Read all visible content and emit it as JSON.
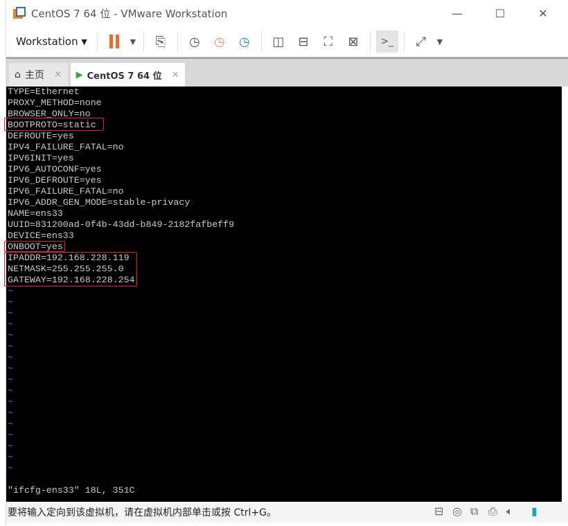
{
  "window": {
    "title": "CentOS 7 64 位 - VMware Workstation"
  },
  "toolbar": {
    "workstation_label": "Workstation"
  },
  "tabs": [
    {
      "label": "主页",
      "icon": "home-icon"
    },
    {
      "label": "CentOS 7 64 位",
      "icon": "vm-icon",
      "active": true
    }
  ],
  "terminal": {
    "lines": [
      "TYPE=Ethernet",
      "PROXY_METHOD=none",
      "BROWSER_ONLY=no",
      "BOOTPROTO=static",
      "DEFROUTE=yes",
      "IPV4_FAILURE_FATAL=no",
      "IPV6INIT=yes",
      "IPV6_AUTOCONF=yes",
      "IPV6_DEFROUTE=yes",
      "IPV6_FAILURE_FATAL=no",
      "IPV6_ADDR_GEN_MODE=stable-privacy",
      "NAME=ens33",
      "UUID=831200ad-0f4b-43dd-b849-2182fafbeff9",
      "DEVICE=ens33",
      "ONBOOT=yes",
      "IPADDR=192.168.228.119",
      "NETMASK=255.255.255.0",
      "GATEWAY=192.168.228.254"
    ],
    "tilde": "~",
    "status": "\"ifcfg-ens33\" 18L, 351C",
    "highlight_color": "#e02020"
  },
  "statusbar": {
    "message": "要将输入定向到该虚拟机，请在虚拟机内部单击或按 Ctrl+G。",
    "devices": [
      "hard-disk-icon",
      "cd-icon",
      "network-icon",
      "printer-icon",
      "sound-icon",
      "notes-icon"
    ]
  }
}
